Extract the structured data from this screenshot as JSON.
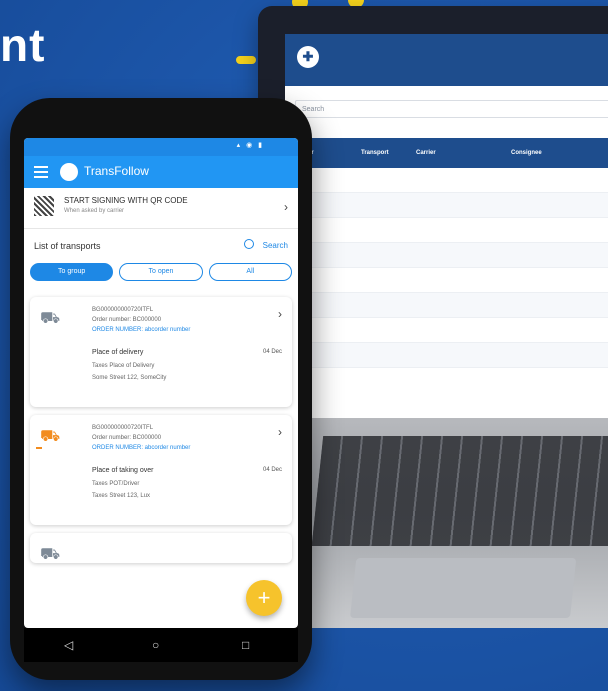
{
  "headline": {
    "text": "nt"
  },
  "colors": {
    "background": "#1d57ab",
    "accent": "#f5d21c",
    "primary": "#1e88e5",
    "laptop_header": "#1e4d8d"
  },
  "laptop": {
    "search_placeholder": "Search",
    "columns": [
      "Number",
      "Transport",
      "Carrier",
      "Consignee"
    ]
  },
  "phone": {
    "app_title": "TransFollow",
    "signing": {
      "title": "START SIGNING WITH QR CODE",
      "subtitle": "When asked by carrier"
    },
    "list_title": "List of transports",
    "search_label": "Search",
    "filters": [
      "To group",
      "To open",
      "All"
    ],
    "cards": [
      {
        "number": "BG000000000720ITFL",
        "order": "Order number: BC000000",
        "order_ref": "ORDER NUMBER: abcorder number",
        "place_label": "Place of delivery",
        "date": "04 Dec",
        "place_name": "Taxes Place of Delivery",
        "address": "Some Street 122, SomeCity"
      },
      {
        "number": "BG000000000720ITFL",
        "order": "Order number: BC000000",
        "order_ref": "ORDER NUMBER: abcorder number",
        "place_label": "Place of taking over",
        "date": "04 Dec",
        "place_name": "Taxes POT/Driver",
        "address": "Taxes Street 123, Lux"
      }
    ]
  }
}
